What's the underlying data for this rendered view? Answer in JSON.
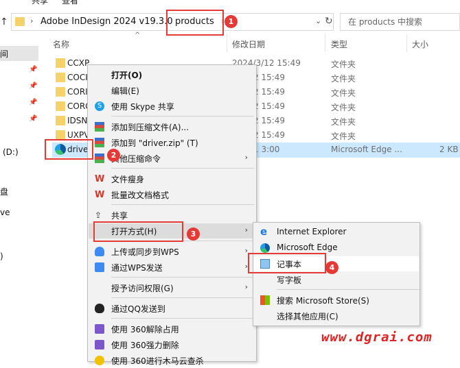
{
  "ribbon": {
    "share": "共享",
    "view": "查看"
  },
  "address": {
    "segments": [
      "Adobe InDesign 2024 v19.3.0",
      "products"
    ],
    "search_placeholder": "在 products 中搜索"
  },
  "columns": {
    "name": "名称",
    "date": "修改日期",
    "type": "类型",
    "size": "大小"
  },
  "nav": {
    "item1": "间",
    "drive_label": "(D:)",
    "item3": "盘",
    "item4": "ve",
    "item5": ")"
  },
  "files": [
    {
      "name": "CCXP",
      "date": "2024/3/12 15:49",
      "type": "文件夹",
      "size": ""
    },
    {
      "name": "COCI",
      "date": "8/3/12 15:49",
      "type": "文件夹",
      "size": ""
    },
    {
      "name": "CORI",
      "date": "8/3/12 15:49",
      "type": "文件夹",
      "size": ""
    },
    {
      "name": "CORG",
      "date": "8/3/12 15:49",
      "type": "文件夹",
      "size": ""
    },
    {
      "name": "IDSN",
      "date": "8/3/12 15:49",
      "type": "文件夹",
      "size": ""
    },
    {
      "name": "UXPV",
      "date": "8/3/12 15:49",
      "type": "文件夹",
      "size": ""
    },
    {
      "name": "drive",
      "date": "8/3/11 3:00",
      "type": "Microsoft Edge ...",
      "size": "2 KB"
    }
  ],
  "menu": {
    "open": "打开(O)",
    "edit": "编辑(E)",
    "skype": "使用 Skype 共享",
    "add_archive": "添加到压缩文件(A)...",
    "add_zip": "添加到 \"driver.zip\" (T)",
    "other_compress": "其他压缩命令",
    "slim": "文件瘦身",
    "batch_convert": "批量改文档格式",
    "share": "共享",
    "open_with": "打开方式(H)",
    "upload_wps": "上传或同步到WPS",
    "send_wps": "通过WPS发送",
    "grant_access": "授予访问权限(G)",
    "send_qq": "通过QQ发送到",
    "unlock_360": "使用 360解除占用",
    "delete_360": "使用 360强力删除",
    "scan_360": "使用 360进行木马云查杀"
  },
  "submenu": {
    "ie": "Internet Explorer",
    "edge": "Microsoft Edge",
    "notepad": "记事本",
    "wordpad": "写字板",
    "store": "搜索 Microsoft Store(S)",
    "other_app": "选择其他应用(C)"
  },
  "badges": [
    "1",
    "2",
    "3",
    "4"
  ],
  "watermark": "www.dgrai.com",
  "colors": {
    "selection": "#cce8ff",
    "annotation": "#e53935",
    "folder": "#f6d26b"
  }
}
